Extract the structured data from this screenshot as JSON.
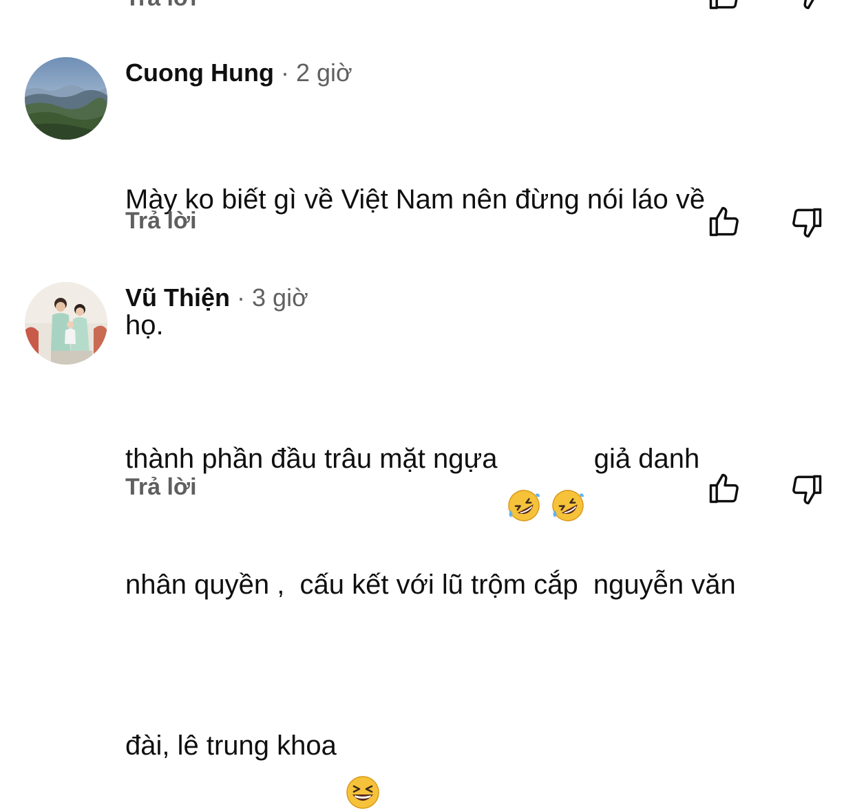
{
  "comments": [
    {
      "author": "Cuong Hung",
      "separator": "·",
      "time": "2 giờ",
      "lines": [
        "Mày ko biết gì về Việt Nam nên đừng nói láo về",
        "họ."
      ],
      "reply_label": "Trả lời"
    },
    {
      "author": "Vũ Thiện",
      "separator": "·",
      "time": "3 giờ",
      "line1_text": "thành phần đầu trâu mặt ngựa ",
      "line1_after": " giả danh",
      "line2": "nhân quyền ,  cấu kết với lũ trộm cắp  nguyễn văn",
      "line3_text": "đài, lê trung khoa ",
      "reply_label": "Trả lời"
    }
  ],
  "top_partial": {
    "reply_label": "Trả lời"
  },
  "icons": {
    "like": "thumbs-up-icon",
    "dislike": "thumbs-down-icon",
    "emoji_rofl": "rolling-on-floor-laughing-emoji",
    "emoji_grin": "grinning-squinting-face-emoji"
  },
  "colors": {
    "text": "#0f0f0f",
    "secondary": "#606060",
    "icon": "#0f0f0f",
    "emoji_yellow": "#f6c23a"
  }
}
